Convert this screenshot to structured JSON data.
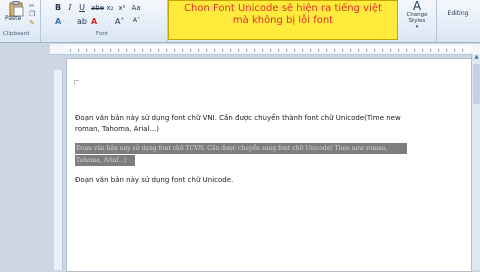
{
  "ribbon": {
    "clipboard": {
      "paste_label": "Paste",
      "group_label": "Clipboard"
    },
    "font": {
      "bold": "B",
      "italic": "I",
      "underline": "U",
      "strike": "abe",
      "subscript": "x₂",
      "superscript": "x²",
      "clear_format": "Aa",
      "text_effects": "A",
      "highlight": "ab",
      "font_color": "A",
      "grow_font": "A˄",
      "shrink_font": "A˅",
      "group_label": "Font"
    },
    "styles": {
      "change_styles_label": "Change Styles",
      "dropdown": "▾"
    },
    "editing": {
      "label": "Editing"
    }
  },
  "callout": {
    "line_1": "Chon Font Unicode sẽ hiện ra tiếng việt",
    "line_2": "mà không bị lỗi font"
  },
  "document": {
    "para_1_line_1": "Đoạn văn bản này sử dụng font chữ VNI. Cần được chuyển thành  font chữ Unicode(Time new",
    "para_1_line_2": "roman, Tahoma, Arial...)",
    "selected_line_1": "Đoạn văn bản này sử dụng font chữ TCVN.  Cần được chuyển sang font chữ Unicode( Time new roman,",
    "selected_line_2": "Tahoma, Arial...)",
    "para_3": "Đoạn văn bản này sử dụng font chữ Unicode."
  },
  "icons": [
    "paste-icon",
    "cut-icon",
    "copy-icon",
    "format-painter-icon",
    "change-styles-icon",
    "scroll-up-icon"
  ],
  "colors": {
    "callout_bg": "#ffeb3c",
    "callout_text": "#e0302a",
    "selection": "#7d7d7d"
  }
}
